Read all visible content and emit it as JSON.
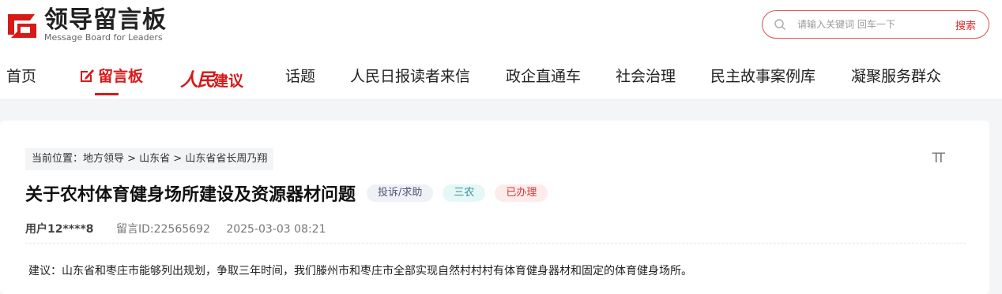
{
  "header": {
    "logo_title": "领导留言板",
    "logo_subtitle": "Message Board for Leaders",
    "search_placeholder": "请输入关键词 回车一下",
    "search_button": "搜索"
  },
  "nav": {
    "home": "首页",
    "board": "留言板",
    "people_script": "人民",
    "people_suffix": "建议",
    "topics": "话题",
    "letters": "人民日报读者来信",
    "direct": "政企直通车",
    "governance": "社会治理",
    "democracy": "民主故事案例库",
    "service": "凝聚服务群众"
  },
  "breadcrumb": "当前位置：地方领导 > 山东省 > 山东省省长周乃翔",
  "font_toggle": "TT",
  "message": {
    "title": "关于农村体育健身场所建设及资源器材问题",
    "tags": {
      "type": "投诉/求助",
      "category": "三农",
      "status": "已办理"
    },
    "user": "用户12****8",
    "message_id": "留言ID:22565692",
    "datetime": "2025-03-03 08:21",
    "content": "建议：山东省和枣庄市能够列出规划，争取三年时间，我们滕州市和枣庄市全部实现自然村村村有体育健身器材和固定的体育健身场所。"
  },
  "colors": {
    "brand_red": "#d71918",
    "search_border": "#d9534f"
  }
}
